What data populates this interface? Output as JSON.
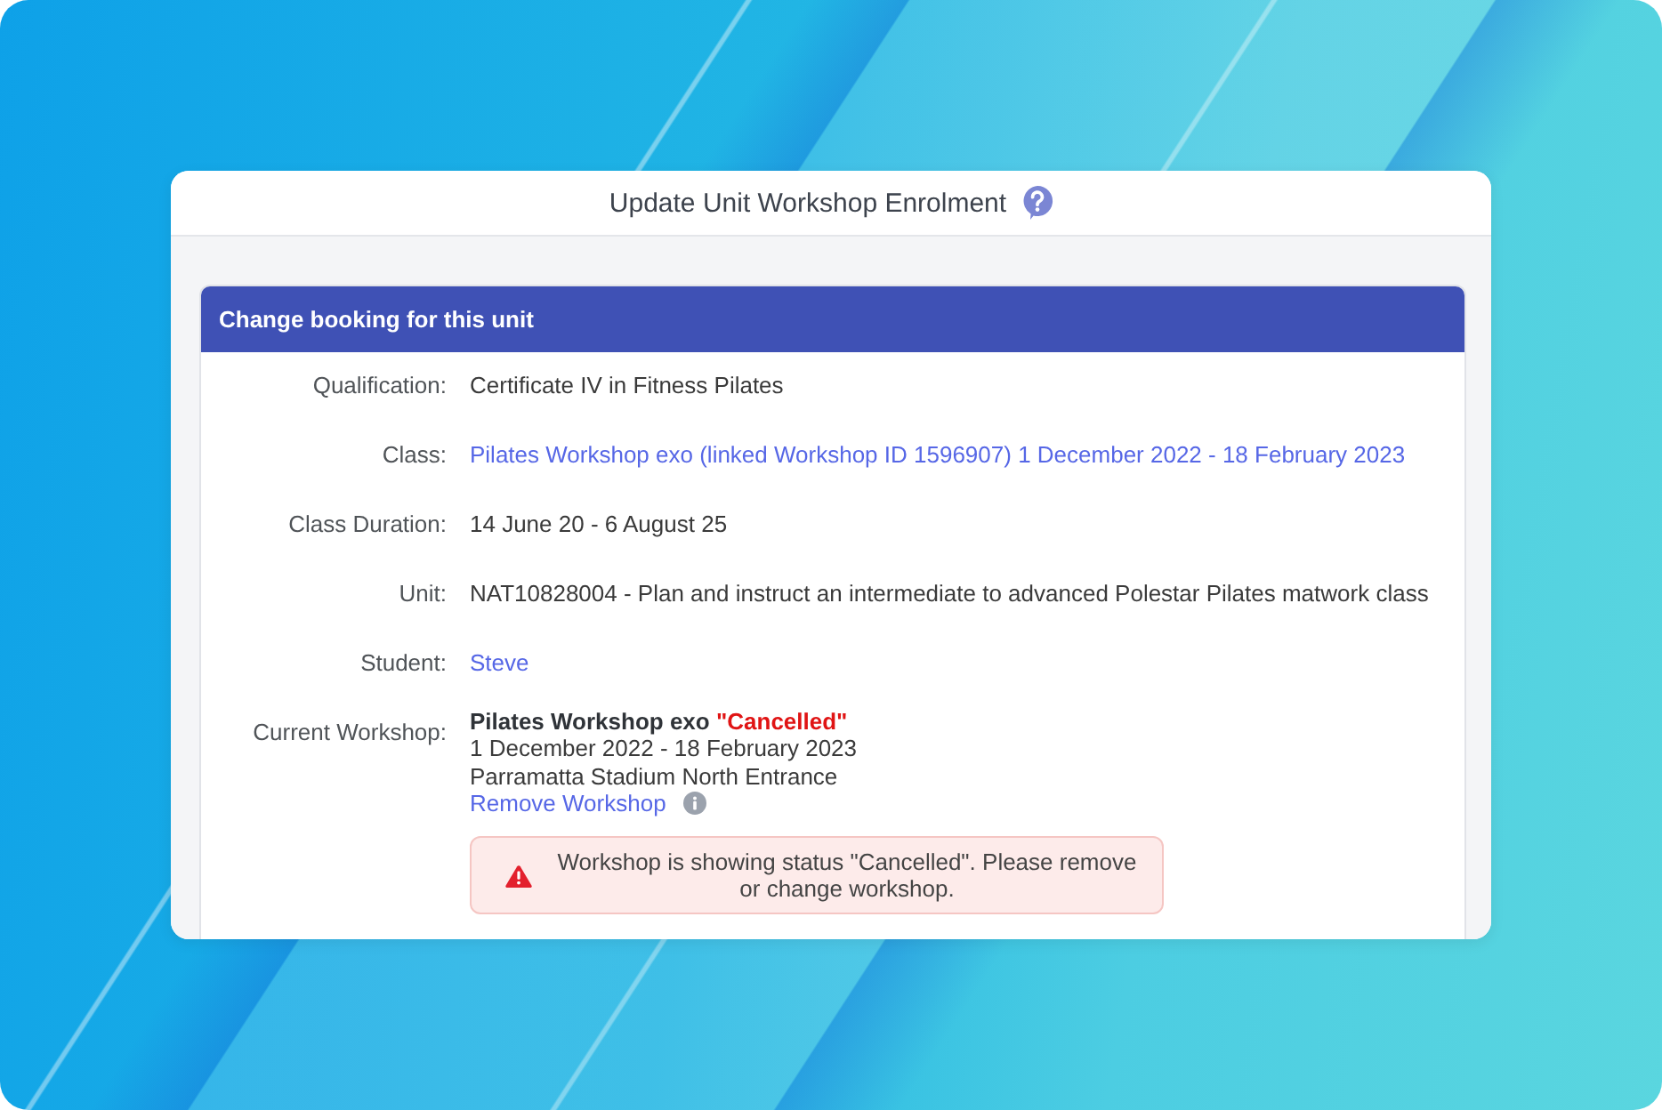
{
  "dialog": {
    "title": "Update Unit Workshop Enrolment"
  },
  "panel": {
    "title": "Change booking for this unit",
    "rows": [
      {
        "kind": "text",
        "label": "Qualification:",
        "value": "Certificate IV in Fitness Pilates"
      },
      {
        "kind": "link",
        "label": "Class:",
        "value": "Pilates Workshop exo (linked Workshop ID 1596907) 1 December 2022 - 18 February 2023"
      },
      {
        "kind": "text",
        "label": "Class Duration:",
        "value": "14 June 20 - 6 August 25"
      },
      {
        "kind": "text",
        "label": "Unit:",
        "value": "NAT10828004 - Plan and instruct an intermediate to advanced Polestar Pilates matwork class"
      },
      {
        "kind": "link",
        "label": "Student:",
        "value": "Steve"
      },
      {
        "kind": "workshop",
        "label": "Current Workshop:",
        "name": "Pilates Workshop exo",
        "status": "\"Cancelled\"",
        "dates": "1 December 2022 - 18 February 2023",
        "venue": "Parramatta Stadium North Entrance",
        "action": "Remove Workshop",
        "alert": {
          "kind": "error",
          "text": "Workshop is showing status \"Cancelled\". Please remove or change workshop."
        }
      }
    ]
  }
}
